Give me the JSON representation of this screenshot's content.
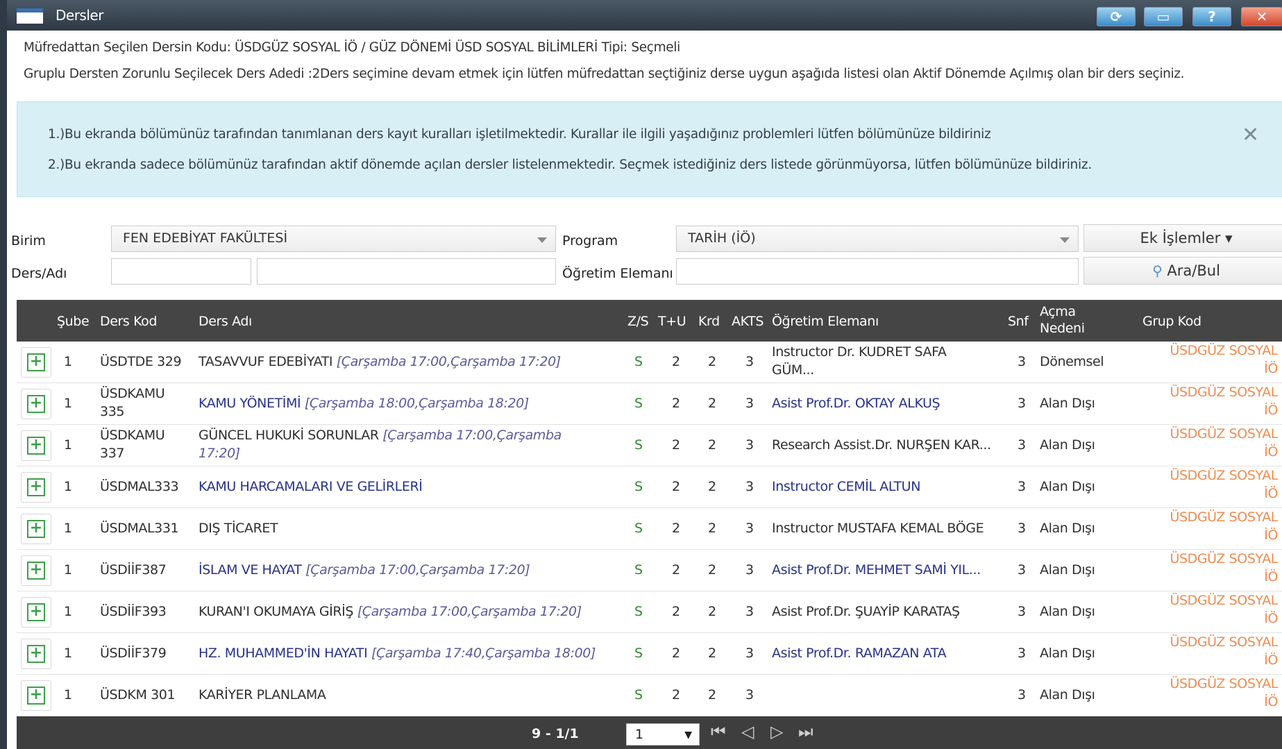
{
  "window": {
    "title": "Dersler",
    "buttons": {
      "refresh": "⟳",
      "minimize": "▭",
      "help": "?",
      "close": "✕"
    }
  },
  "info": {
    "line1": "Müfredattan Seçilen Dersin Kodu: ÜSDGÜZ SOSYAL İÖ / GÜZ DÖNEMİ ÜSD SOSYAL BİLİMLERİ Tipi: Seçmeli",
    "line2": "Gruplu Dersten Zorunlu Seçilecek Ders Adedi :2Ders seçimine devam etmek için lütfen müfredattan seçtiğiniz derse uygun aşağıda listesi olan Aktif Dönemde Açılmış olan bir ders seçiniz."
  },
  "alert": {
    "line1": "1.)Bu ekranda bölümünüz tarafından tanımlanan ders kayıt kuralları işletilmektedir. Kurallar ile ilgili yaşadığınız problemleri lütfen bölümünüze bildiriniz",
    "line2": "2.)Bu ekranda sadece bölümünüz tarafından aktif dönemde açılan dersler listelenmektedir. Seçmek istediğiniz ders listede görünmüyorsa, lütfen bölümünüze bildiriniz.",
    "close": "✕"
  },
  "filters": {
    "birim_label": "Birim",
    "birim_value": "FEN EDEBİYAT FAKÜLTESİ",
    "program_label": "Program",
    "program_value": "TARİH (İÖ)",
    "ek_islemler": "Ek İşlemler ▾",
    "ders_label": "Ders/Adı",
    "ders_kod_value": "",
    "ders_adi_value": "",
    "ogretim_label": "Öğretim Elemanı",
    "ogretim_value": "",
    "search_button": "Ara/Bul",
    "search_icon": "magnifier-icon"
  },
  "table": {
    "headers": {
      "sube": "Şube",
      "ders_kod": "Ders Kod",
      "ders_adi": "Ders Adı",
      "zs": "Z/S",
      "tu": "T+U",
      "krd": "Krd",
      "akts": "AKTS",
      "ogretim": "Öğretim Elemanı",
      "snf": "Snf",
      "acma1": "Açma",
      "acma2": "Nedeni",
      "grup": "Grup Kod"
    },
    "rows": [
      {
        "plus": "+",
        "sube": "1",
        "kod1": "ÜSDTDE 329",
        "kod2": "",
        "adi": "TASAVVUF EDEBİYATI",
        "sched1": "[Çarşamba 17:00,Çarşamba 17:20]",
        "sched2": "",
        "zs": "S",
        "tu": "2",
        "krd": "2",
        "akts": "3",
        "ogr1": "Instructor Dr. KUDRET SAFA",
        "ogr2": "GÜM...",
        "snf": "3",
        "acma": "Dönemsel",
        "grup1": "ÜSDGÜZ SOSYAL",
        "grup2": "İÖ",
        "adi_link": false,
        "ogr_link": false
      },
      {
        "plus": "+",
        "sube": "1",
        "kod1": "ÜSDKAMU",
        "kod2": "335",
        "adi": "KAMU YÖNETİMİ",
        "sched1": "[Çarşamba 18:00,Çarşamba 18:20]",
        "sched2": "",
        "zs": "S",
        "tu": "2",
        "krd": "2",
        "akts": "3",
        "ogr1": "Asist Prof.Dr. OKTAY ALKUŞ",
        "ogr2": "",
        "snf": "3",
        "acma": "Alan Dışı",
        "grup1": "ÜSDGÜZ SOSYAL",
        "grup2": "İÖ",
        "adi_link": true,
        "ogr_link": true
      },
      {
        "plus": "+",
        "sube": "1",
        "kod1": "ÜSDKAMU",
        "kod2": "337",
        "adi": "GÜNCEL HUKUKİ SORUNLAR",
        "sched1": "[Çarşamba 17:00,Çarşamba",
        "sched2": "17:20]",
        "zs": "S",
        "tu": "2",
        "krd": "2",
        "akts": "3",
        "ogr1": "Research Assist.Dr. NURŞEN KAR...",
        "ogr2": "",
        "snf": "3",
        "acma": "Alan Dışı",
        "grup1": "ÜSDGÜZ SOSYAL",
        "grup2": "İÖ",
        "adi_link": false,
        "ogr_link": false
      },
      {
        "plus": "+",
        "sube": "1",
        "kod1": "ÜSDMAL333",
        "kod2": "",
        "adi": "KAMU HARCAMALARI VE GELİRLERİ",
        "sched1": "",
        "sched2": "",
        "zs": "S",
        "tu": "2",
        "krd": "2",
        "akts": "3",
        "ogr1": "Instructor CEMİL ALTUN",
        "ogr2": "",
        "snf": "3",
        "acma": "Alan Dışı",
        "grup1": "ÜSDGÜZ SOSYAL",
        "grup2": "İÖ",
        "adi_link": true,
        "ogr_link": true
      },
      {
        "plus": "+",
        "sube": "1",
        "kod1": "ÜSDMAL331",
        "kod2": "",
        "adi": "DIŞ TİCARET",
        "sched1": "",
        "sched2": "",
        "zs": "S",
        "tu": "2",
        "krd": "2",
        "akts": "3",
        "ogr1": "Instructor MUSTAFA KEMAL BÖGE",
        "ogr2": "",
        "snf": "3",
        "acma": "Alan Dışı",
        "grup1": "ÜSDGÜZ SOSYAL",
        "grup2": "İÖ",
        "adi_link": false,
        "ogr_link": false
      },
      {
        "plus": "+",
        "sube": "1",
        "kod1": "ÜSDİİF387",
        "kod2": "",
        "adi": "İSLAM VE HAYAT",
        "sched1": "[Çarşamba 17:00,Çarşamba 17:20]",
        "sched2": "",
        "zs": "S",
        "tu": "2",
        "krd": "2",
        "akts": "3",
        "ogr1": "Asist Prof.Dr. MEHMET SAMİ YIL...",
        "ogr2": "",
        "snf": "3",
        "acma": "Alan Dışı",
        "grup1": "ÜSDGÜZ SOSYAL",
        "grup2": "İÖ",
        "adi_link": true,
        "ogr_link": true
      },
      {
        "plus": "+",
        "sube": "1",
        "kod1": "ÜSDİİF393",
        "kod2": "",
        "adi": "KURAN'I OKUMAYA GİRİŞ",
        "sched1": "[Çarşamba 17:00,Çarşamba 17:20]",
        "sched2": "",
        "zs": "S",
        "tu": "2",
        "krd": "2",
        "akts": "3",
        "ogr1": "Asist Prof.Dr. ŞUAYİP KARATAŞ",
        "ogr2": "",
        "snf": "3",
        "acma": "Alan Dışı",
        "grup1": "ÜSDGÜZ SOSYAL",
        "grup2": "İÖ",
        "adi_link": false,
        "ogr_link": false
      },
      {
        "plus": "+",
        "sube": "1",
        "kod1": "ÜSDİİF379",
        "kod2": "",
        "adi": "HZ. MUHAMMED'İN HAYATI",
        "sched1": "[Çarşamba 17:40,Çarşamba 18:00]",
        "sched2": "",
        "zs": "S",
        "tu": "2",
        "krd": "2",
        "akts": "3",
        "ogr1": "Asist Prof.Dr. RAMAZAN ATA",
        "ogr2": "",
        "snf": "3",
        "acma": "Alan Dışı",
        "grup1": "ÜSDGÜZ SOSYAL",
        "grup2": "İÖ",
        "adi_link": true,
        "ogr_link": true
      },
      {
        "plus": "+",
        "sube": "1",
        "kod1": "ÜSDKM 301",
        "kod2": "",
        "adi": "KARİYER PLANLAMA",
        "sched1": "",
        "sched2": "",
        "zs": "S",
        "tu": "2",
        "krd": "2",
        "akts": "3",
        "ogr1": "",
        "ogr2": "",
        "snf": "3",
        "acma": "Alan Dışı",
        "grup1": "ÜSDGÜZ SOSYAL",
        "grup2": "İÖ",
        "adi_link": false,
        "ogr_link": false
      }
    ]
  },
  "pager": {
    "count": "9 - 1/1",
    "page": "1",
    "first": "⏮",
    "prev": "◁",
    "next": "▷",
    "last": "⏭"
  },
  "colors": {
    "titlebar": "#34404b",
    "alert_bg": "#d9eff6",
    "grid_header": "#454545",
    "link": "#27328a",
    "accent_green": "#2c8a2c",
    "group_orange": "#f08b4f"
  }
}
